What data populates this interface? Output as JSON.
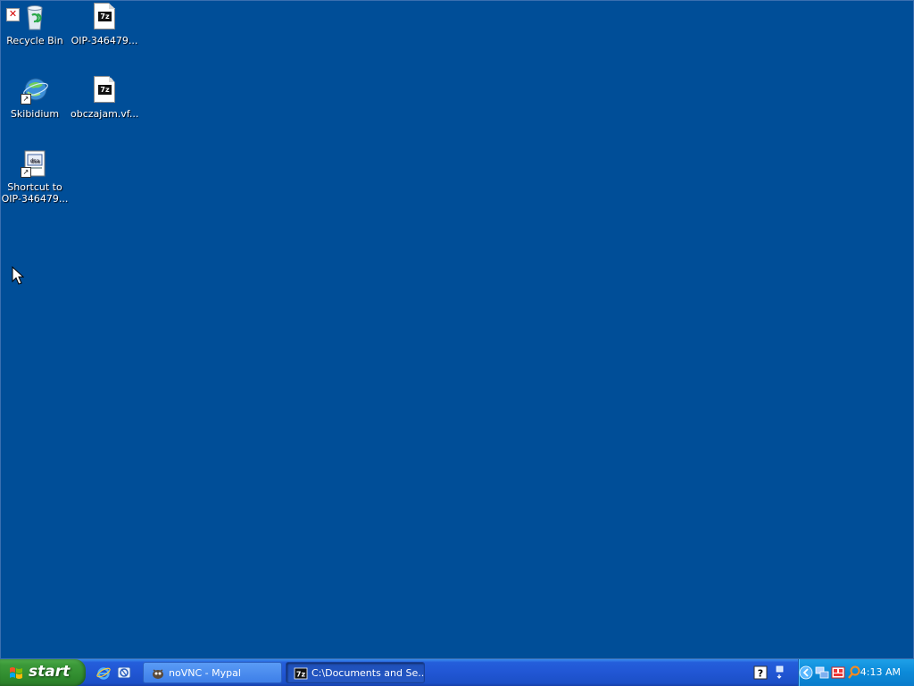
{
  "desktop": {
    "icons": [
      {
        "label": "Recycle Bin"
      },
      {
        "label": "OIP-346479..."
      },
      {
        "label": "Skibidium"
      },
      {
        "label": "obczajam.vf..."
      },
      {
        "label_line1": "Shortcut to",
        "label_line2": "OIP-346479..."
      }
    ],
    "file_badge": "7z",
    "background_color": "#004e98"
  },
  "taskbar": {
    "start_label": "start",
    "tasks": [
      {
        "label": "noVNC - Mypal",
        "state": "inactive"
      },
      {
        "label": "C:\\Documents and Se...",
        "state": "active"
      }
    ],
    "clock": "4:13 AM",
    "tray_icons": [
      "help-icon",
      "volume-icon",
      "arrow-icon",
      "network-icon",
      "app-icon",
      "magnifier-icon"
    ]
  }
}
